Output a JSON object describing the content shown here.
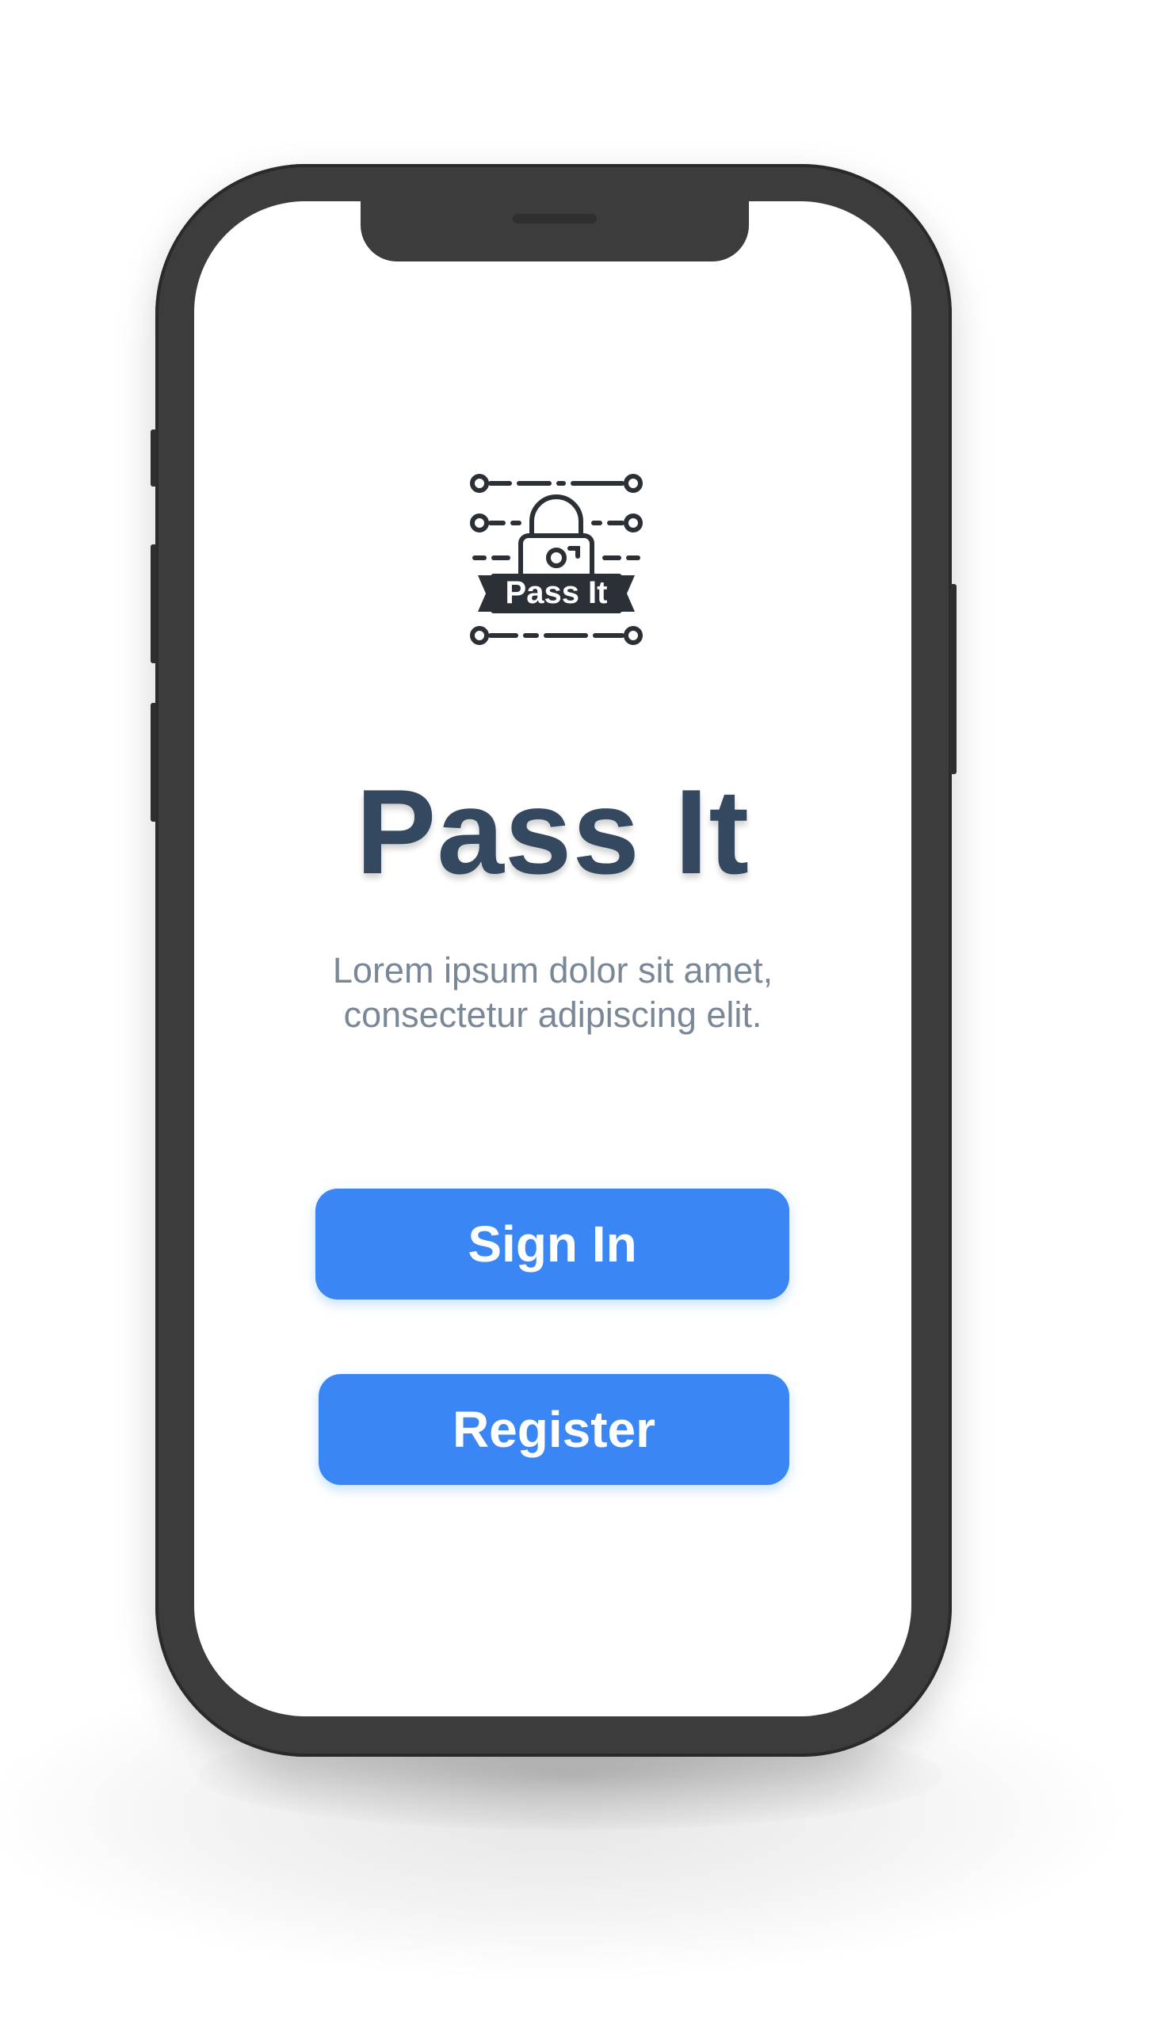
{
  "app": {
    "name": "Pass It",
    "tagline_line1": "Lorem ipsum dolor sit amet,",
    "tagline_line2": "consectetur adipiscing elit.",
    "logo_text": "Pass It"
  },
  "actions": {
    "sign_in_label": "Sign In",
    "register_label": "Register"
  },
  "icons": {
    "logo": "padlock-circuit-logo-icon"
  },
  "colors": {
    "primary": "#3a86f5",
    "title": "#344860",
    "subtitle": "#7a8796",
    "device_frame": "#3c3c3c",
    "logo_ink": "#2b2f36"
  }
}
